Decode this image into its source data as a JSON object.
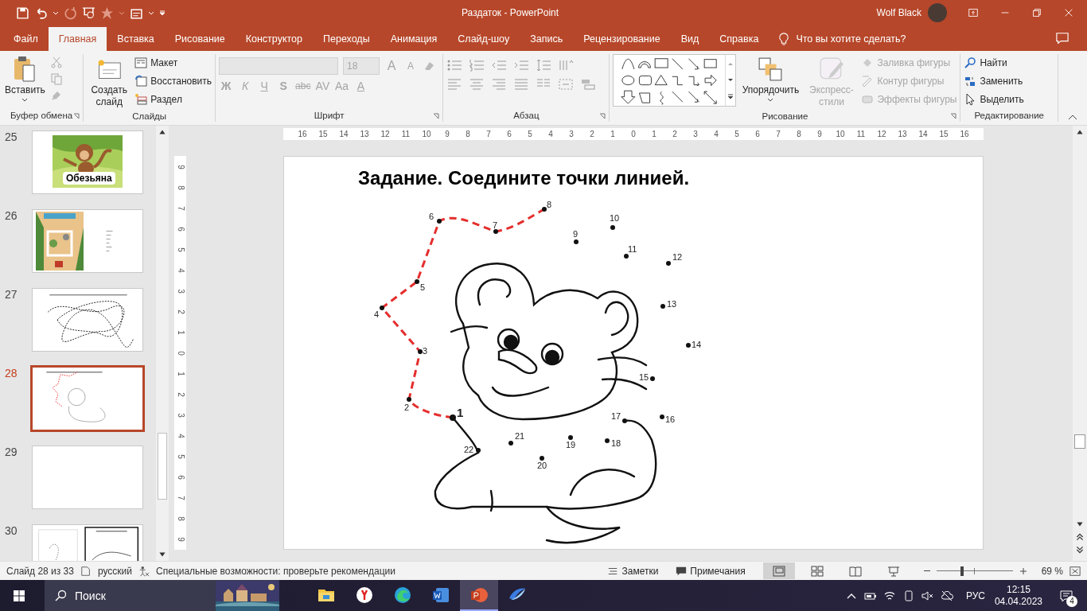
{
  "title_bar": {
    "document": "Раздаток - PowerPoint",
    "user": "Wolf Black"
  },
  "tabs": [
    {
      "label": "Файл",
      "selected": false
    },
    {
      "label": "Главная",
      "selected": true
    },
    {
      "label": "Вставка",
      "selected": false
    },
    {
      "label": "Рисование",
      "selected": false
    },
    {
      "label": "Конструктор",
      "selected": false
    },
    {
      "label": "Переходы",
      "selected": false
    },
    {
      "label": "Анимация",
      "selected": false
    },
    {
      "label": "Слайд-шоу",
      "selected": false
    },
    {
      "label": "Запись",
      "selected": false
    },
    {
      "label": "Рецензирование",
      "selected": false
    },
    {
      "label": "Вид",
      "selected": false
    },
    {
      "label": "Справка",
      "selected": false
    }
  ],
  "tell_me": "Что вы хотите сделать?",
  "ribbon": {
    "clipboard": {
      "paste": "Вставить",
      "tools_disabled": true,
      "title": "Буфер обмена"
    },
    "slides": {
      "new_slide": "Создать слайд",
      "layout": "Макет",
      "reset": "Восстановить",
      "section": "Раздел",
      "title": "Слайды"
    },
    "font": {
      "disabled": true,
      "size": "18",
      "row_1": [
        {
          "kind": "grow",
          "label": "A"
        },
        {
          "kind": "shrink",
          "label": "A"
        }
      ],
      "row_2": [
        {
          "kind": "bold",
          "label": "Ж"
        },
        {
          "kind": "italic",
          "label": "К"
        },
        {
          "kind": "underline",
          "label": "Ч"
        },
        {
          "kind": "shadow",
          "label": "S"
        },
        {
          "kind": "strike",
          "label": "abc"
        },
        {
          "kind": "spacing",
          "label": "AV"
        },
        {
          "kind": "case",
          "label": "Aa"
        },
        {
          "kind": "color",
          "label": "A"
        }
      ],
      "title": "Шрифт"
    },
    "paragraph": {
      "title": "Абзац"
    },
    "drawing": {
      "arrange": "Упорядочить",
      "quick_styles": {
        "label": "Экспресс-стили",
        "disabled": true
      },
      "format_items": [
        {
          "label": "Заливка фигуры",
          "disabled": true
        },
        {
          "label": "Контур фигуры",
          "disabled": true
        },
        {
          "label": "Эффекты фигуры",
          "disabled": true
        }
      ],
      "title": "Рисование"
    },
    "editing": {
      "items": [
        "Найти",
        "Заменить",
        "Выделить"
      ],
      "title": "Редактирование"
    }
  },
  "thumbnails": [
    {
      "number": "25",
      "kind": "monkey",
      "caption": "Обезьяна",
      "selected": false
    },
    {
      "number": "26",
      "kind": "map",
      "selected": false
    },
    {
      "number": "27",
      "kind": "maze",
      "selected": false
    },
    {
      "number": "28",
      "kind": "dots",
      "selected": true
    },
    {
      "number": "29",
      "kind": "blank",
      "selected": false
    },
    {
      "number": "30",
      "kind": "split",
      "selected": false
    }
  ],
  "ruler": {
    "horizontal": [
      "16",
      "15",
      "14",
      "13",
      "12",
      "11",
      "10",
      "9",
      "8",
      "7",
      "6",
      "5",
      "4",
      "3",
      "2",
      "1",
      "0",
      "1",
      "2",
      "3",
      "4",
      "5",
      "6",
      "7",
      "8",
      "9",
      "10",
      "11",
      "12",
      "13",
      "14",
      "15",
      "16"
    ],
    "vertical": [
      "9",
      "8",
      "7",
      "6",
      "5",
      "4",
      "3",
      "2",
      "1",
      "0",
      "1",
      "2",
      "3",
      "4",
      "5",
      "6",
      "7",
      "8",
      "9"
    ]
  },
  "slide": {
    "title": "Задание. Соедините точки линией.",
    "dots": [
      {
        "label": "1",
        "kind": "start"
      },
      {
        "label": "2",
        "kind": "point"
      },
      {
        "label": "3",
        "kind": "point"
      },
      {
        "label": "4",
        "kind": "point"
      },
      {
        "label": "5",
        "kind": "point"
      },
      {
        "label": "6",
        "kind": "point"
      },
      {
        "label": "7",
        "kind": "point"
      },
      {
        "label": "8",
        "kind": "point"
      },
      {
        "label": "9",
        "kind": "point"
      },
      {
        "label": "10",
        "kind": "point"
      },
      {
        "label": "11",
        "kind": "point"
      },
      {
        "label": "12",
        "kind": "point"
      },
      {
        "label": "13",
        "kind": "point"
      },
      {
        "label": "14",
        "kind": "point"
      },
      {
        "label": "15",
        "kind": "point"
      },
      {
        "label": "16",
        "kind": "point"
      },
      {
        "label": "17",
        "kind": "point"
      },
      {
        "label": "18",
        "kind": "point"
      },
      {
        "label": "19",
        "kind": "point"
      },
      {
        "label": "20",
        "kind": "point"
      },
      {
        "label": "21",
        "kind": "point"
      },
      {
        "label": "22",
        "kind": "point"
      }
    ]
  },
  "status_bar": {
    "slide": "Слайд 28 из 33",
    "language": "русский",
    "accessibility": "Специальные возможности: проверьте рекомендации",
    "notes": "Заметки",
    "comments": "Примечания",
    "views": [
      {
        "kind": "normal",
        "selected": true
      },
      {
        "kind": "sorter",
        "selected": false
      },
      {
        "kind": "reading",
        "selected": false
      },
      {
        "kind": "show",
        "selected": false
      }
    ],
    "zoom": {
      "level": 0.34,
      "reading": "69 %"
    }
  },
  "taskbar": {
    "search": "Поиск",
    "apps": [
      {
        "kind": "folder",
        "selected": false
      },
      {
        "kind": "yandex",
        "selected": false
      },
      {
        "kind": "edge",
        "selected": false
      },
      {
        "kind": "word",
        "selected": false
      },
      {
        "kind": "powerpoint",
        "selected": true
      },
      {
        "kind": "swoosh",
        "selected": false
      }
    ],
    "language": "РУС",
    "time": "12:15",
    "date": "04.04.2023",
    "notifications": "4"
  }
}
